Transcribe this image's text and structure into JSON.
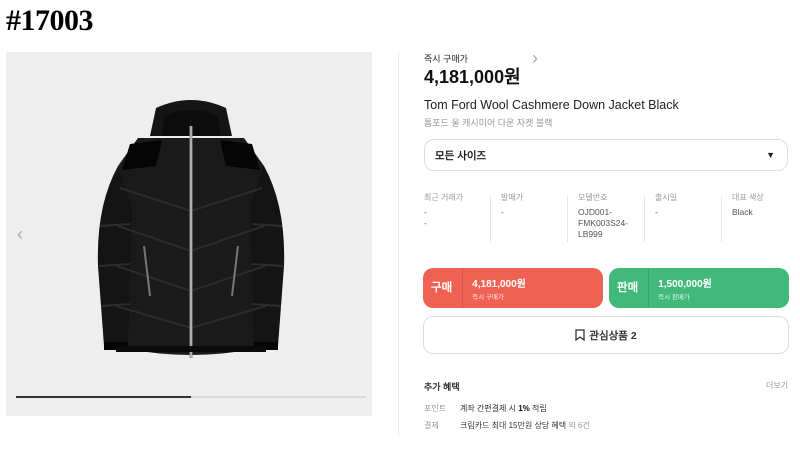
{
  "tag": "#17003",
  "gallery": {
    "image_alt": "black down jacket",
    "progress_fraction": 0.5
  },
  "product": {
    "instant_buy_label": "즉시 구매가",
    "instant_buy_price": "4,181,000원",
    "name_en": "Tom Ford Wool Cashmere Down Jacket Black",
    "name_ko": "톰포드 울 캐시미어 다운 자켓 블랙"
  },
  "size_select": {
    "value": "모든 사이즈"
  },
  "info": [
    {
      "label": "최근 거래가",
      "values": [
        "-",
        "-"
      ]
    },
    {
      "label": "발매가",
      "values": [
        "-"
      ]
    },
    {
      "label": "모델번호",
      "values": [
        "OJD001-",
        "FMK003S24-",
        "LB999"
      ]
    },
    {
      "label": "출시일",
      "values": [
        "-"
      ]
    },
    {
      "label": "대표 색상",
      "values": [
        "Black"
      ]
    }
  ],
  "buy": {
    "label": "구매",
    "price": "4,181,000원",
    "sub": "즉시 구매가"
  },
  "sell": {
    "label": "판매",
    "price": "1,500,000원",
    "sub": "즉시 판매가"
  },
  "wish": {
    "label": "관심상품 2"
  },
  "benefits": {
    "title": "추가 혜택",
    "more": "더보기",
    "rows": [
      {
        "key": "포인트",
        "text_pre": "계좌 간편결제 시 ",
        "text_bold": "1%",
        "text_post": " 적립"
      },
      {
        "key": "결제",
        "text_pre": "크림카드 최대 15만원 상당 혜택 ",
        "text_bold": "",
        "text_post": "외 6건"
      }
    ]
  },
  "colors": {
    "buy": "#ef6253",
    "sell": "#41b979"
  }
}
